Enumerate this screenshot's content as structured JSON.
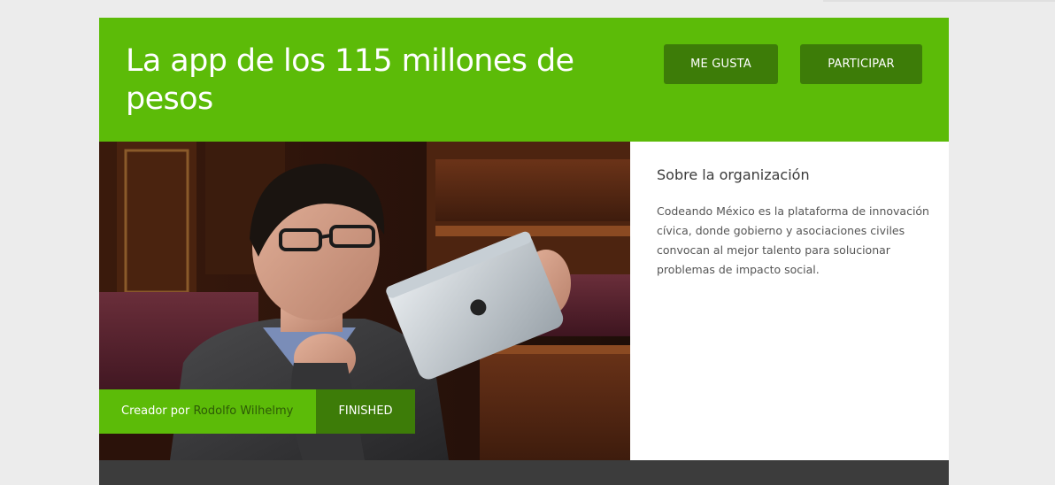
{
  "project": {
    "title": "La app de los 115 millones de pesos",
    "like_label": "ME GUSTA",
    "participate_label": "PARTICIPAR"
  },
  "hero": {
    "image": "photo of a man in glasses reading an iPad in a parliament seat",
    "creator_prefix": "Creador por",
    "creator_name": "Rodolfo Wilhelmy",
    "status": "FINISHED"
  },
  "organization": {
    "heading": "Sobre la organización",
    "description": "Codeando México es la plataforma de innovación cívica, donde gobierno y asociaciones civiles convocan al mejor talento para solucionar problemas de impacto social."
  },
  "colors": {
    "brand_green": "#5cbb08",
    "dark_green": "#3d7c08",
    "page_background": "#ececec",
    "footer_band": "#3c3c3c"
  }
}
